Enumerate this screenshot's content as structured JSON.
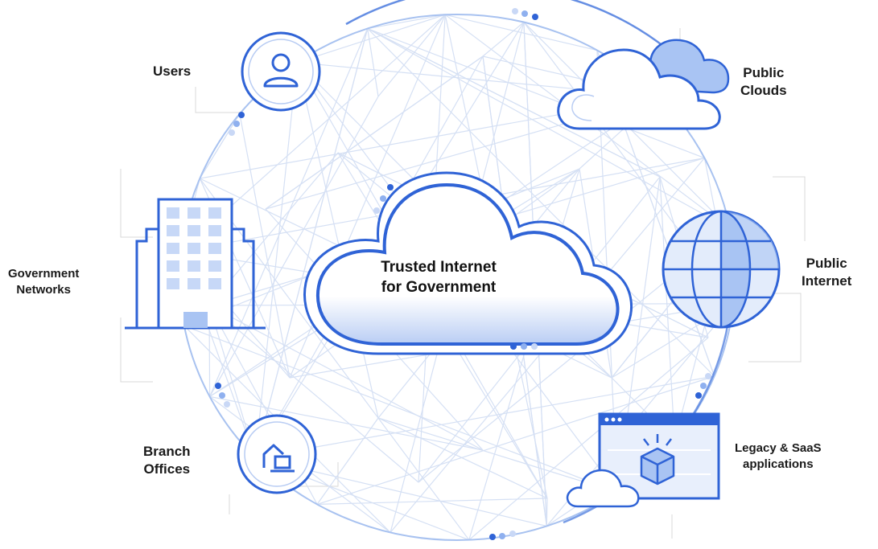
{
  "center": {
    "line1": "Trusted Internet",
    "line2": "for Government"
  },
  "nodes": {
    "users": {
      "label": "Users"
    },
    "public_clouds": {
      "line1": "Public",
      "line2": "Clouds"
    },
    "government_networks": {
      "line1": "Government",
      "line2": "Networks"
    },
    "public_internet": {
      "line1": "Public",
      "line2": "Internet"
    },
    "branch_offices": {
      "line1": "Branch",
      "line2": "Offices"
    },
    "legacy_saas": {
      "line1": "Legacy & SaaS",
      "line2": "applications"
    }
  },
  "colors": {
    "primary_blue": "#2f63d6",
    "light_blue": "#dce7fb",
    "mid_blue": "#9dbbf2",
    "mesh_line": "#d3def3",
    "text": "#1a1a1a"
  },
  "icons": [
    "user-icon",
    "cloud-icon",
    "building-icon",
    "globe-icon",
    "home-laptop-icon",
    "app-window-icon"
  ]
}
